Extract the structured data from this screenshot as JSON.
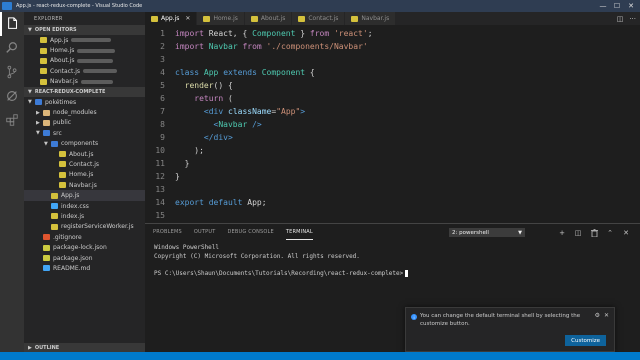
{
  "window": {
    "title": "App.js - react-redux-complete - Visual Studio Code",
    "controls": [
      "—",
      "☐",
      "✕"
    ]
  },
  "activity_bar": [
    "explorer-icon",
    "search-icon",
    "source-control-icon",
    "debug-icon",
    "extensions-icon"
  ],
  "sidebar": {
    "title": "EXPLORER",
    "open_editors_label": "OPEN EDITORS",
    "open_editors": [
      {
        "label": "App.js",
        "icon": "js"
      },
      {
        "label": "Home.js",
        "icon": "js"
      },
      {
        "label": "About.js",
        "icon": "js"
      },
      {
        "label": "Contact.js",
        "icon": "js"
      },
      {
        "label": "Navbar.js",
        "icon": "js"
      }
    ],
    "project_label": "REACT-REDUX-COMPLETE",
    "tree": [
      {
        "label": "pokétimes",
        "type": "folder",
        "depth": 0,
        "open": true
      },
      {
        "label": "node_modules",
        "type": "folder",
        "depth": 1,
        "open": false
      },
      {
        "label": "public",
        "type": "folder",
        "depth": 1,
        "open": false
      },
      {
        "label": "src",
        "type": "folder",
        "depth": 1,
        "open": true
      },
      {
        "label": "components",
        "type": "folder",
        "depth": 2,
        "open": true
      },
      {
        "label": "About.js",
        "type": "js",
        "depth": 3
      },
      {
        "label": "Contact.js",
        "type": "js",
        "depth": 3
      },
      {
        "label": "Home.js",
        "type": "js",
        "depth": 3
      },
      {
        "label": "Navbar.js",
        "type": "js",
        "depth": 3
      },
      {
        "label": "App.js",
        "type": "js",
        "depth": 2,
        "selected": true
      },
      {
        "label": "index.css",
        "type": "css",
        "depth": 2
      },
      {
        "label": "index.js",
        "type": "js",
        "depth": 2
      },
      {
        "label": "registerServiceWorker.js",
        "type": "js",
        "depth": 2
      },
      {
        "label": ".gitignore",
        "type": "git",
        "depth": 1
      },
      {
        "label": "package-lock.json",
        "type": "json",
        "depth": 1
      },
      {
        "label": "package.json",
        "type": "json",
        "depth": 1
      },
      {
        "label": "README.md",
        "type": "md",
        "depth": 1
      }
    ],
    "outline_label": "OUTLINE"
  },
  "tabs": [
    {
      "label": "App.js",
      "active": true
    },
    {
      "label": "Home.js",
      "active": false
    },
    {
      "label": "About.js",
      "active": false
    },
    {
      "label": "Contact.js",
      "active": false
    },
    {
      "label": "Navbar.js",
      "active": false
    }
  ],
  "editor": {
    "lines": [
      [
        [
          "k",
          "import"
        ],
        [
          "plain",
          " React, { "
        ],
        [
          "cls",
          "Component"
        ],
        [
          "plain",
          " } "
        ],
        [
          "k",
          "from"
        ],
        [
          "str",
          " 'react'"
        ],
        [
          "plain",
          ";"
        ]
      ],
      [
        [
          "k",
          "import"
        ],
        [
          "plain",
          " "
        ],
        [
          "cls",
          "Navbar"
        ],
        [
          "k",
          " from"
        ],
        [
          "str",
          " './components/Navbar'"
        ]
      ],
      [],
      [
        [
          "kw",
          "class"
        ],
        [
          "plain",
          " "
        ],
        [
          "cls",
          "App"
        ],
        [
          "kw",
          " extends"
        ],
        [
          "plain",
          " "
        ],
        [
          "cls",
          "Component"
        ],
        [
          "plain",
          " {"
        ]
      ],
      [
        [
          "plain",
          "  "
        ],
        [
          "fn",
          "render"
        ],
        [
          "plain",
          "() {"
        ]
      ],
      [
        [
          "plain",
          "    "
        ],
        [
          "k",
          "return"
        ],
        [
          "plain",
          " ("
        ]
      ],
      [
        [
          "plain",
          "      "
        ],
        [
          "tag",
          "<div"
        ],
        [
          "plain",
          " "
        ],
        [
          "attr",
          "className"
        ],
        [
          "plain",
          "="
        ],
        [
          "str",
          "\"App\""
        ],
        [
          "tag",
          ">"
        ]
      ],
      [
        [
          "plain",
          "        "
        ],
        [
          "tag",
          "<"
        ],
        [
          "comp",
          "Navbar"
        ],
        [
          "plain",
          " "
        ],
        [
          "tag",
          "/>"
        ]
      ],
      [
        [
          "plain",
          "      "
        ],
        [
          "tag",
          "</div>"
        ]
      ],
      [
        [
          "plain",
          "    );"
        ]
      ],
      [
        [
          "plain",
          "  }"
        ]
      ],
      [
        [
          "plain",
          "}"
        ]
      ],
      [],
      [
        [
          "kw",
          "export"
        ],
        [
          "kw",
          " default"
        ],
        [
          "plain",
          " App;"
        ]
      ],
      []
    ]
  },
  "panel": {
    "tabs": [
      {
        "label": "PROBLEMS",
        "active": false
      },
      {
        "label": "OUTPUT",
        "active": false
      },
      {
        "label": "DEBUG CONSOLE",
        "active": false
      },
      {
        "label": "TERMINAL",
        "active": true
      }
    ],
    "terminal_select": "2: powershell",
    "tools": [
      "+",
      "◫",
      "🗑",
      "⌃",
      "✕"
    ],
    "terminal_lines": [
      "Windows PowerShell",
      "Copyright (C) Microsoft Corporation. All rights reserved.",
      "",
      "PS C:\\Users\\Shaun\\Documents\\Tutorials\\Recording\\react-redux-complete>"
    ]
  },
  "notification": {
    "message": "You can change the default terminal shell by selecting the customize button.",
    "button": "Customize"
  },
  "colors": {
    "titlebar": "#2f3d52",
    "statusbar": "#007acc",
    "accent_button": "#0e639c"
  }
}
